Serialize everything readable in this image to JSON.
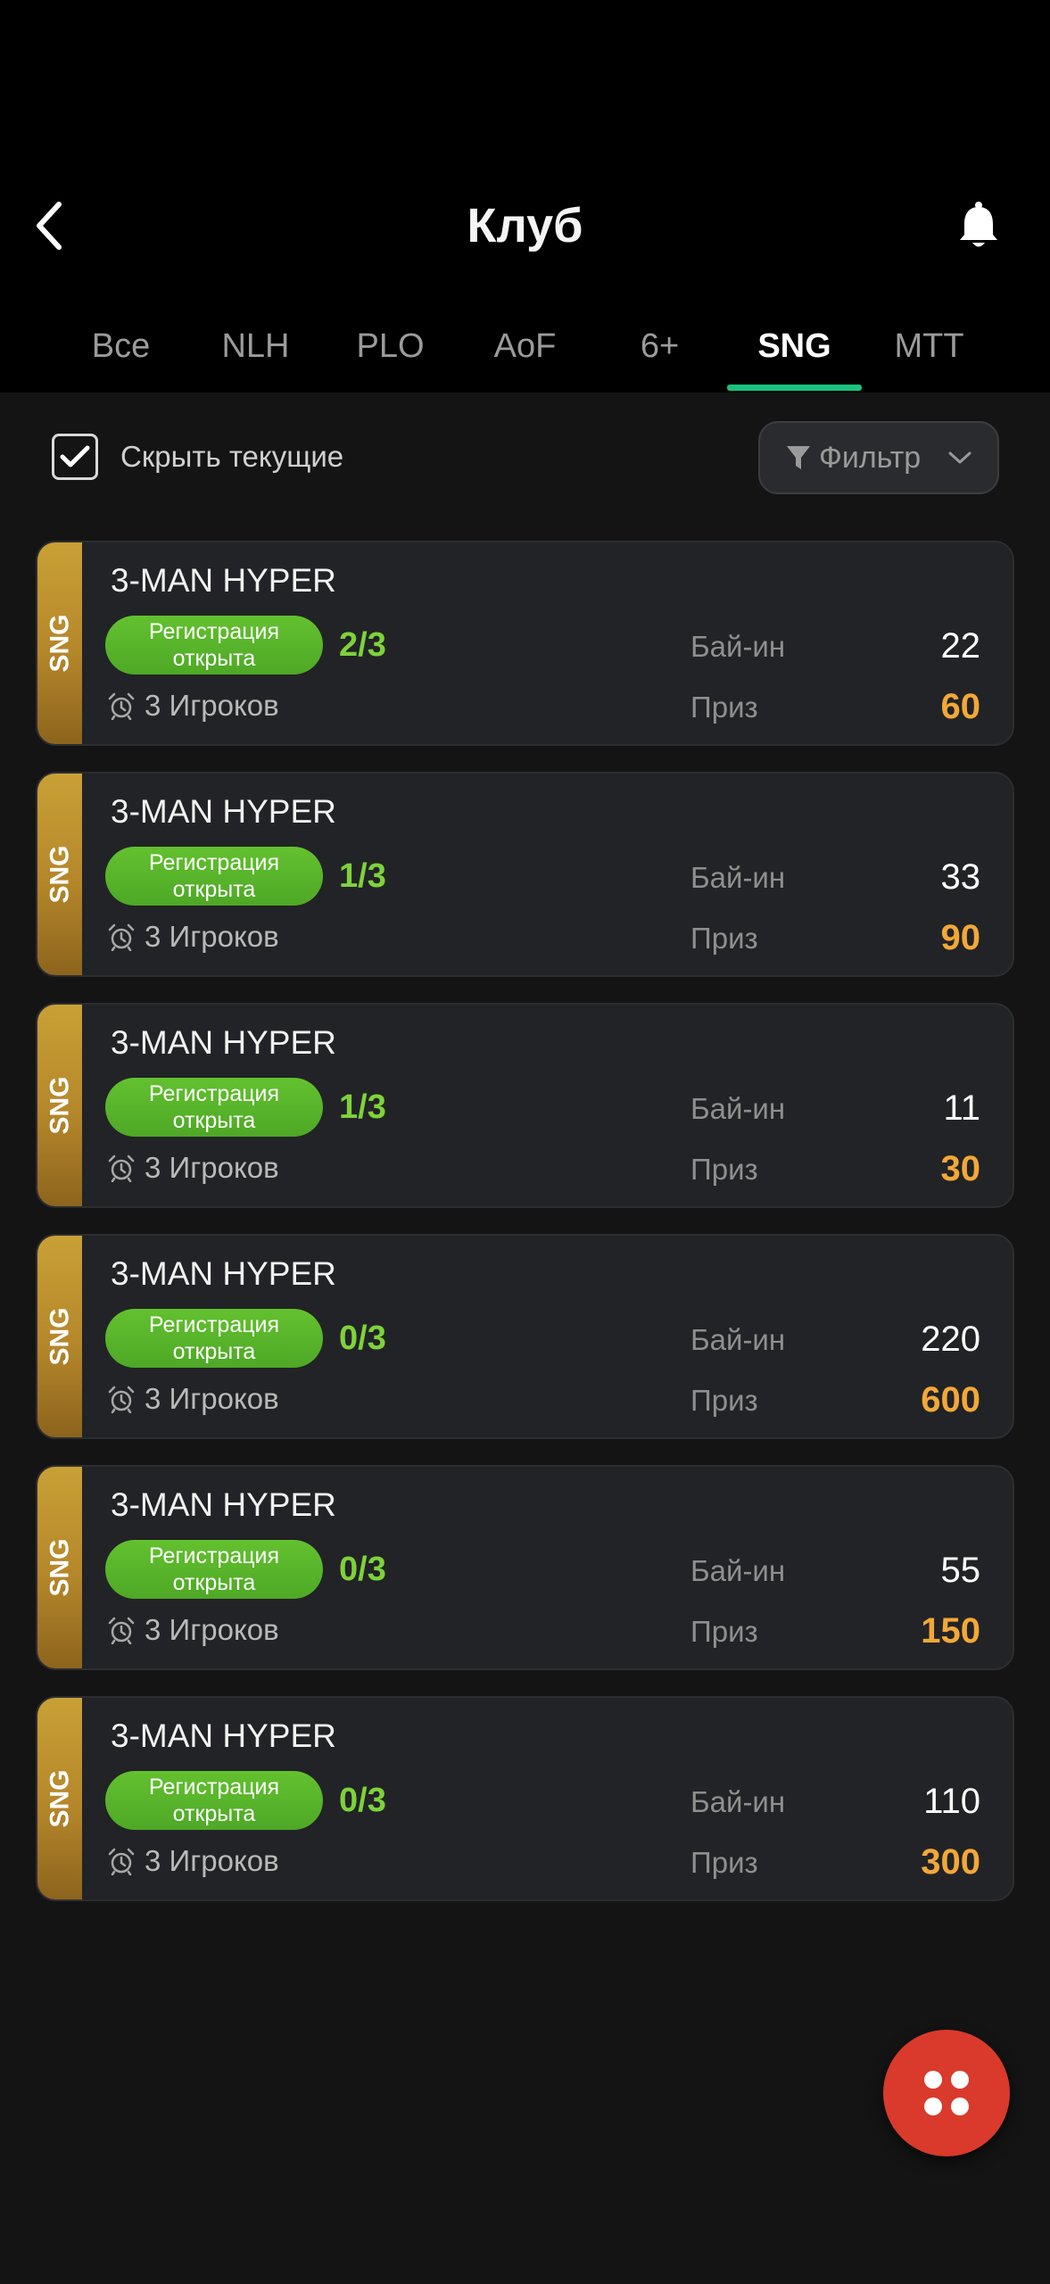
{
  "header": {
    "title": "Клуб"
  },
  "tabs": [
    {
      "label": "Все"
    },
    {
      "label": "NLH"
    },
    {
      "label": "PLO"
    },
    {
      "label": "AoF"
    },
    {
      "label": "6+"
    },
    {
      "label": "SNG",
      "active": true
    },
    {
      "label": "MTT"
    }
  ],
  "filter_bar": {
    "hide_current_label": "Скрыть текущие",
    "hide_current_checked": true,
    "filter_label": "Фильтр"
  },
  "tournaments": [
    {
      "type": "SNG",
      "title": "3-MAN HYPER",
      "status_line1": "Регистрация",
      "status_line2": "открыта",
      "seats": "2/3",
      "players": "3 Игроков",
      "buyin_label": "Бай-ин",
      "buyin": "22",
      "prize_label": "Приз",
      "prize": "60"
    },
    {
      "type": "SNG",
      "title": "3-MAN HYPER",
      "status_line1": "Регистрация",
      "status_line2": "открыта",
      "seats": "1/3",
      "players": "3 Игроков",
      "buyin_label": "Бай-ин",
      "buyin": "33",
      "prize_label": "Приз",
      "prize": "90"
    },
    {
      "type": "SNG",
      "title": "3-MAN HYPER",
      "status_line1": "Регистрация",
      "status_line2": "открыта",
      "seats": "1/3",
      "players": "3 Игроков",
      "buyin_label": "Бай-ин",
      "buyin": "11",
      "prize_label": "Приз",
      "prize": "30"
    },
    {
      "type": "SNG",
      "title": "3-MAN HYPER",
      "status_line1": "Регистрация",
      "status_line2": "открыта",
      "seats": "0/3",
      "players": "3 Игроков",
      "buyin_label": "Бай-ин",
      "buyin": "220",
      "prize_label": "Приз",
      "prize": "600"
    },
    {
      "type": "SNG",
      "title": "3-MAN HYPER",
      "status_line1": "Регистрация",
      "status_line2": "открыта",
      "seats": "0/3",
      "players": "3 Игроков",
      "buyin_label": "Бай-ин",
      "buyin": "55",
      "prize_label": "Приз",
      "prize": "150"
    },
    {
      "type": "SNG",
      "title": "3-MAN HYPER",
      "status_line1": "Регистрация",
      "status_line2": "открыта",
      "seats": "0/3",
      "players": "3 Игроков",
      "buyin_label": "Бай-ин",
      "buyin": "110",
      "prize_label": "Приз",
      "prize": "300"
    }
  ],
  "icons": {
    "back": "chevron-left-icon",
    "notifications": "bell-icon",
    "filter": "funnel-icon",
    "dropdown": "chevron-down-icon",
    "players": "alarm-clock-icon",
    "menu_fab": "four-dots-icon"
  },
  "colors": {
    "accent_tab_underline": "#19c37d",
    "status_green": "#5bb52a",
    "seats_green": "#7ed23a",
    "prize_orange": "#f2a838",
    "sng_stripe_gold": "#b4862a",
    "fab_red": "#d93a2b"
  }
}
